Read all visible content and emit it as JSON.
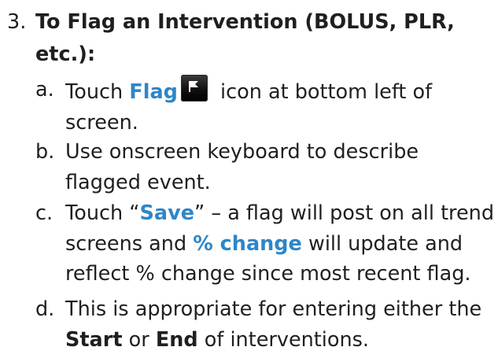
{
  "step": {
    "number": "3.",
    "title": "To Flag an Intervention (BOLUS, PLR, etc.):",
    "substeps": [
      {
        "letter": "a.",
        "parts": [
          "Touch ",
          "Flag",
          " icon at bottom left of screen."
        ]
      },
      {
        "letter": "b.",
        "text": "Use onscreen keyboard to describe flagged event."
      },
      {
        "letter": "c.",
        "parts": [
          "Touch “",
          "Save",
          "” – a flag will post on all trend screens and ",
          "% change",
          " will update and reflect % change since most recent flag."
        ]
      },
      {
        "letter": "d.",
        "parts": [
          "This is appropriate for entering either the ",
          "Start",
          " or ",
          "End",
          " of interventions."
        ]
      }
    ]
  },
  "icons": {
    "flag": "flag-icon"
  },
  "colors": {
    "text": "#1f1f1f",
    "accent": "#2e86c8",
    "icon_bg": "#111111",
    "icon_fg": "#ffffff"
  }
}
